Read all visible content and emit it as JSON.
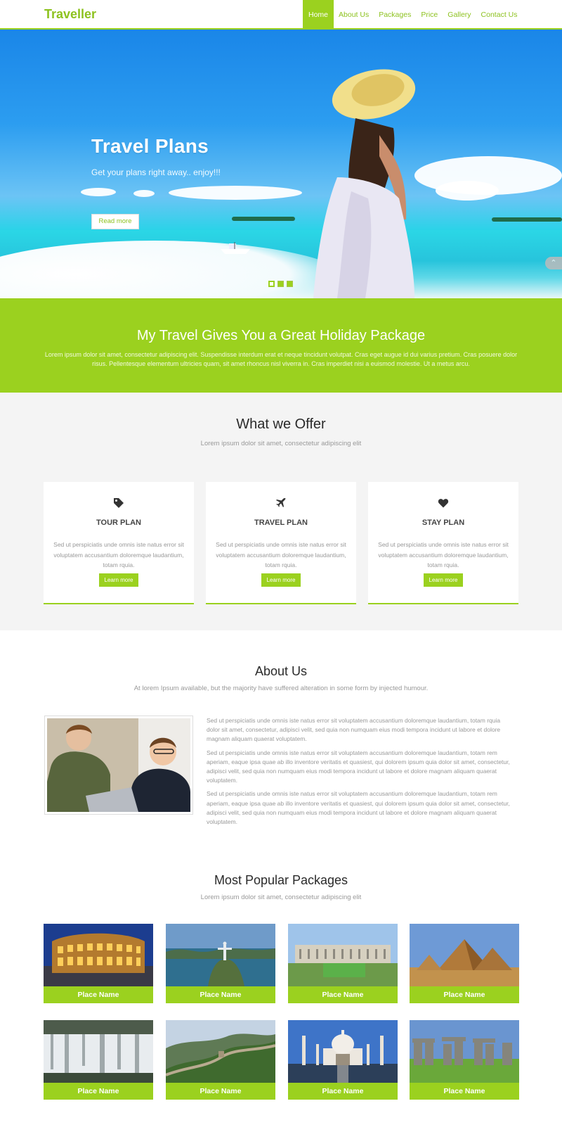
{
  "header": {
    "logo": "Traveller",
    "nav": [
      {
        "label": "Home",
        "active": true
      },
      {
        "label": "About Us"
      },
      {
        "label": "Packages"
      },
      {
        "label": "Price"
      },
      {
        "label": "Gallery"
      },
      {
        "label": "Contact Us"
      }
    ]
  },
  "hero": {
    "title": "Travel Plans",
    "subtitle": "Get your plans right away.. enjoy!!!",
    "button": "Read more",
    "slides": 3,
    "active_slide": 1
  },
  "banner": {
    "title": "My Travel Gives You a Great Holiday Package",
    "text": "Lorem ipsum dolor sit amet, consectetur adipiscing elit. Suspendisse interdum erat et neque tincidunt volutpat. Cras eget augue id dui varius pretium. Cras posuere dolor risus. Pellentesque elementum ultricies quam, sit amet rhoncus nisl viverra in. Cras imperdiet nisi a euismod molestie. Ut a metus arcu."
  },
  "offer": {
    "title": "What we Offer",
    "subtitle": "Lorem ipsum dolor sit amet, consectetur adipiscing elit",
    "cards": [
      {
        "icon": "tag-icon",
        "title": "TOUR PLAN",
        "text": "Sed ut perspiciatis unde omnis iste natus error sit voluptatem accusantium doloremque laudantium, totam rquia.",
        "button": "Learn more"
      },
      {
        "icon": "plane-icon",
        "title": "TRAVEL PLAN",
        "text": "Sed ut perspiciatis unde omnis iste natus error sit voluptatem accusantium doloremque laudantium, totam rquia.",
        "button": "Learn more"
      },
      {
        "icon": "heart-icon",
        "title": "STAY PLAN",
        "text": "Sed ut perspiciatis unde omnis iste natus error sit voluptatem accusantium doloremque laudantium, totam rquia.",
        "button": "Learn more"
      }
    ]
  },
  "about": {
    "title": "About Us",
    "subtitle": "At lorem Ipsum available, but the majority have suffered alteration in some form by injected humour.",
    "paragraphs": [
      "Sed ut perspiciatis unde omnis iste natus error sit voluptatem accusantium doloremque laudantium, totam rquia dolor sit amet, consectetur, adipisci velit, sed quia non numquam eius modi tempora incidunt ut labore et dolore magnam aliquam quaerat voluptatem.",
      "Sed ut perspiciatis unde omnis iste natus error sit voluptatem accusantium doloremque laudantium, totam rem aperiam, eaque ipsa quae ab illo inventore veritatis et quasiest, qui dolorem ipsum quia dolor sit amet, consectetur, adipisci velit, sed quia non numquam eius modi tempora incidunt ut labore et dolore magnam aliquam quaerat voluptatem.",
      "Sed ut perspiciatis unde omnis iste natus error sit voluptatem accusantium doloremque laudantium, totam rem aperiam, eaque ipsa quae ab illo inventore veritatis et quasiest, qui dolorem ipsum quia dolor sit amet, consectetur, adipisci velit, sed quia non numquam eius modi tempora incidunt ut labore et dolore magnam aliquam quaerat voluptatem."
    ]
  },
  "packages": {
    "title": "Most Popular Packages",
    "subtitle": "Lorem ipsum dolor sit amet, consectetur adipiscing elit",
    "items": [
      {
        "label": "Place Name",
        "scene": "colosseum"
      },
      {
        "label": "Place Name",
        "scene": "rio"
      },
      {
        "label": "Place Name",
        "scene": "palace"
      },
      {
        "label": "Place Name",
        "scene": "pyramids"
      },
      {
        "label": "Place Name",
        "scene": "waterfall"
      },
      {
        "label": "Place Name",
        "scene": "great-wall"
      },
      {
        "label": "Place Name",
        "scene": "taj-mahal"
      },
      {
        "label": "Place Name",
        "scene": "stonehenge"
      }
    ]
  },
  "colors": {
    "accent": "#9bd11f",
    "accent_text": "#8dc21f"
  }
}
